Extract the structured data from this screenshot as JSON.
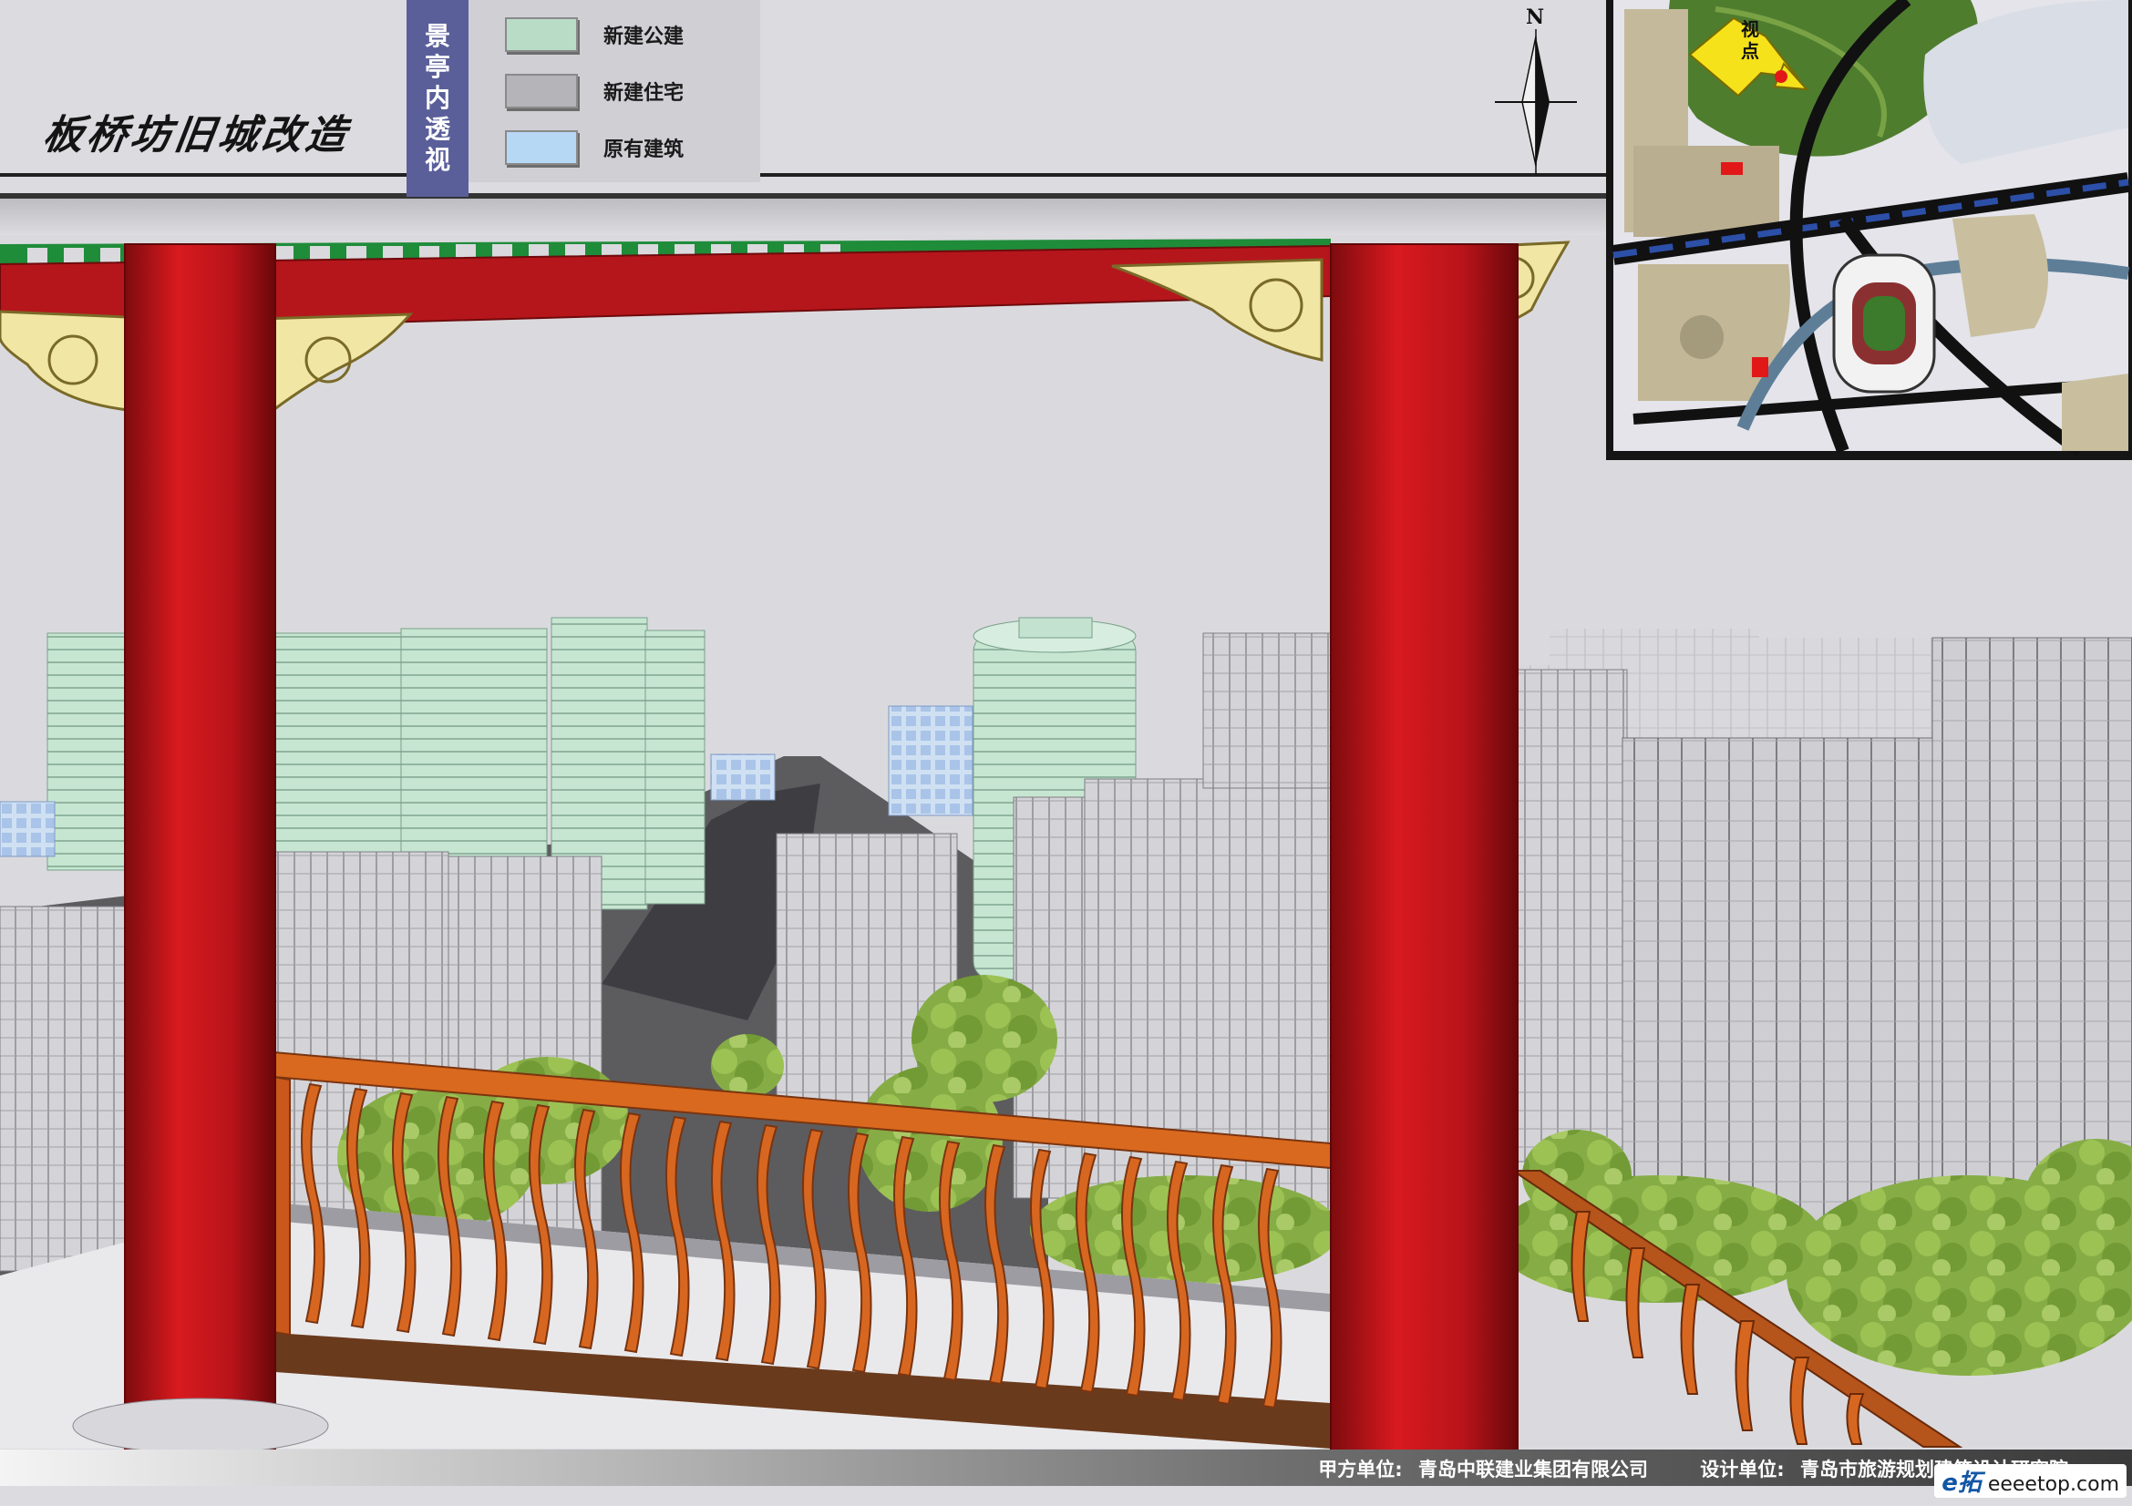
{
  "header": {
    "title": "板桥坊旧城改造",
    "subtitle": [
      "景",
      "亭",
      "内",
      "透",
      "视"
    ]
  },
  "legend": [
    {
      "label": "新建公建",
      "color": "#b9dcc6"
    },
    {
      "label": "新建住宅",
      "color": "#b5b5b9"
    },
    {
      "label": "原有建筑",
      "color": "#b7d8f5"
    }
  ],
  "compass": {
    "label": "N"
  },
  "inset_map": {
    "viewpoint_label": "视点"
  },
  "footer": {
    "client_label": "甲方单位:",
    "client_value": "青岛中联建业集团有限公司",
    "designer_label": "设计单位:",
    "designer_value": "青岛市旅游规划建筑设计研究院",
    "watermark_brand": "e拓",
    "watermark_url": "eeeetop.com"
  },
  "colors": {
    "pillar": "#c0161a",
    "railing": "#d9691e",
    "beam_green": "#1f8c3a",
    "bracket": "#f1e6a4",
    "public_building": "#b9dcc6",
    "residential": "#c7c7cb",
    "sky": "#dadade",
    "tree": "#7fa83a"
  }
}
